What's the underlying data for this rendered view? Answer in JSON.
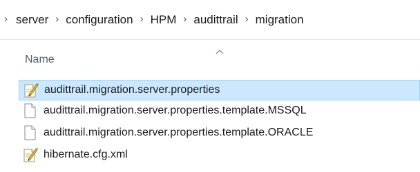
{
  "breadcrumb": {
    "items": [
      "server",
      "configuration",
      "HPM",
      "audittrail",
      "migration"
    ]
  },
  "columns": {
    "name": "Name",
    "sort": "ascending"
  },
  "files": [
    {
      "name": "audittrail.migration.server.properties",
      "icon": "edited-document-icon",
      "selected": true
    },
    {
      "name": "audittrail.migration.server.properties.template.MSSQL",
      "icon": "blank-document-icon",
      "selected": false
    },
    {
      "name": "audittrail.migration.server.properties.template.ORACLE",
      "icon": "blank-document-icon",
      "selected": false
    },
    {
      "name": "hibernate.cfg.xml",
      "icon": "edited-document-icon",
      "selected": false
    }
  ],
  "colors": {
    "selection_background": "#cce8ff",
    "selection_border": "#99d1ff",
    "header_text": "#4c607a"
  }
}
